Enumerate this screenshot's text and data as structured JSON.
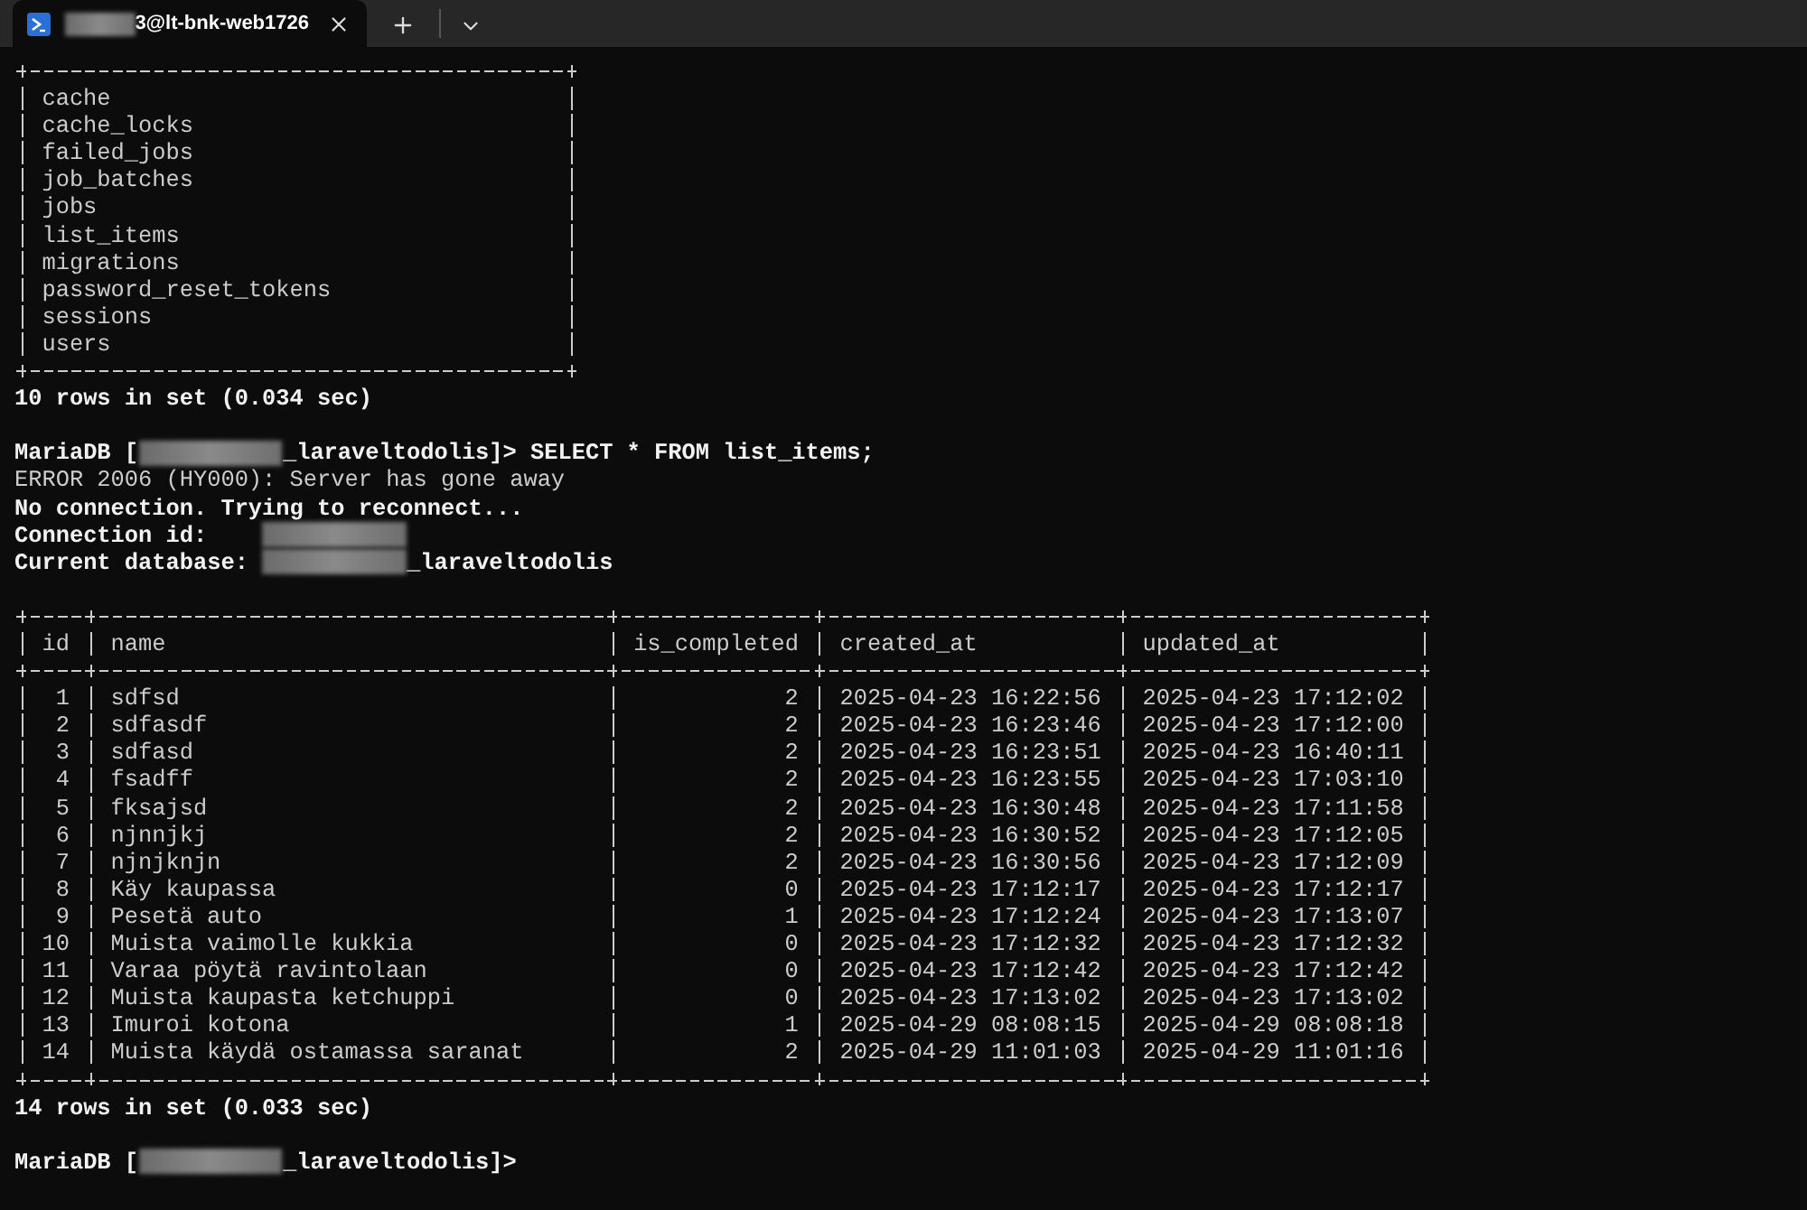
{
  "tab_bar": {
    "tabs": [
      {
        "title": "3@lt-bnk-web1726",
        "title_redacted_before": true,
        "selected": true
      }
    ]
  },
  "terminal": {
    "blocks": [
      {
        "kind": "table",
        "rows": [
          [
            "cache"
          ],
          [
            "cache_locks"
          ],
          [
            "failed_jobs"
          ],
          [
            "job_batches"
          ],
          [
            "jobs"
          ],
          [
            "list_items"
          ],
          [
            "migrations"
          ],
          [
            "password_reset_tokens"
          ],
          [
            "sessions"
          ],
          [
            "users"
          ]
        ]
      },
      {
        "kind": "line",
        "bold": true,
        "parts": [
          {
            "kind": "text",
            "text": "10 rows in set (0.034 sec)"
          }
        ]
      },
      {
        "kind": "blank"
      },
      {
        "kind": "line",
        "bold": true,
        "parts": [
          {
            "kind": "text",
            "text": "MariaDB ["
          },
          {
            "kind": "redacted"
          },
          {
            "kind": "text",
            "text": "_laraveltodolis]> SELECT * FROM list_items;"
          }
        ]
      },
      {
        "kind": "line",
        "bold": false,
        "parts": [
          {
            "kind": "text",
            "text": "ERROR 2006 (HY000): Server has gone away"
          }
        ]
      },
      {
        "kind": "line",
        "bold": true,
        "parts": [
          {
            "kind": "text",
            "text": "No connection. Trying to reconnect..."
          }
        ]
      },
      {
        "kind": "line",
        "bold": true,
        "parts": [
          {
            "kind": "text",
            "text": "Connection id:    "
          },
          {
            "kind": "redacted"
          }
        ]
      },
      {
        "kind": "line",
        "bold": true,
        "parts": [
          {
            "kind": "text",
            "text": "Current database: "
          },
          {
            "kind": "redacted"
          },
          {
            "kind": "text",
            "text": "_laraveltodolis"
          }
        ]
      },
      {
        "kind": "blank"
      },
      {
        "kind": "table",
        "columns": [
          "id",
          "name",
          "is_completed",
          "created_at",
          "updated_at"
        ],
        "rows": [
          [
            "1",
            "sdfsd",
            "2",
            "2025-04-23 16:22:56",
            "2025-04-23 17:12:02"
          ],
          [
            "2",
            "sdfasdf",
            "2",
            "2025-04-23 16:23:46",
            "2025-04-23 17:12:00"
          ],
          [
            "3",
            "sdfasd",
            "2",
            "2025-04-23 16:23:51",
            "2025-04-23 16:40:11"
          ],
          [
            "4",
            "fsadff",
            "2",
            "2025-04-23 16:23:55",
            "2025-04-23 17:03:10"
          ],
          [
            "5",
            "fksajsd",
            "2",
            "2025-04-23 16:30:48",
            "2025-04-23 17:11:58"
          ],
          [
            "6",
            "njnnjkj",
            "2",
            "2025-04-23 16:30:52",
            "2025-04-23 17:12:05"
          ],
          [
            "7",
            "njnjknjn",
            "2",
            "2025-04-23 16:30:56",
            "2025-04-23 17:12:09"
          ],
          [
            "8",
            "Käy kaupassa",
            "0",
            "2025-04-23 17:12:17",
            "2025-04-23 17:12:17"
          ],
          [
            "9",
            "Pesetä auto",
            "1",
            "2025-04-23 17:12:24",
            "2025-04-23 17:13:07"
          ],
          [
            "10",
            "Muista vaimolle kukkia",
            "0",
            "2025-04-23 17:12:32",
            "2025-04-23 17:12:32"
          ],
          [
            "11",
            "Varaa pöytä ravintolaan",
            "0",
            "2025-04-23 17:12:42",
            "2025-04-23 17:12:42"
          ],
          [
            "12",
            "Muista kaupasta ketchuppi",
            "0",
            "2025-04-23 17:13:02",
            "2025-04-23 17:13:02"
          ],
          [
            "13",
            "Imuroi kotona",
            "1",
            "2025-04-29 08:08:15",
            "2025-04-29 08:08:18"
          ],
          [
            "14",
            "Muista käydä ostamassa saranat",
            "2",
            "2025-04-29 11:01:03",
            "2025-04-29 11:01:16"
          ]
        ]
      },
      {
        "kind": "line",
        "bold": true,
        "parts": [
          {
            "kind": "text",
            "text": "14 rows in set (0.033 sec)"
          }
        ]
      },
      {
        "kind": "blank"
      },
      {
        "kind": "line",
        "bold": true,
        "parts": [
          {
            "kind": "text",
            "text": "MariaDB ["
          },
          {
            "kind": "redacted"
          },
          {
            "kind": "text",
            "text": "_laraveltodolis]>"
          }
        ]
      }
    ]
  }
}
